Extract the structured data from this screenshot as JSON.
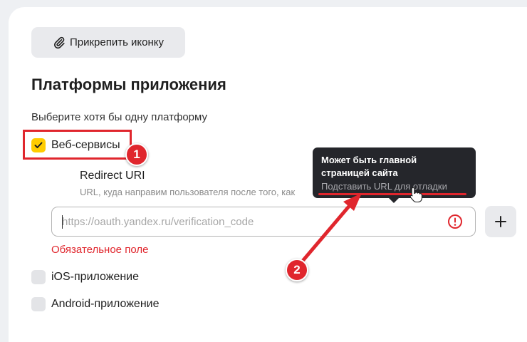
{
  "attach_button": {
    "label": "Прикрепить иконку",
    "icon": "paperclip-icon"
  },
  "platforms": {
    "title": "Платформы приложения",
    "hint": "Выберите хотя бы одну платформу",
    "web": {
      "label": "Веб-сервисы",
      "checked": true
    },
    "ios": {
      "label": "iOS-приложение",
      "checked": false
    },
    "android": {
      "label": "Android-приложение",
      "checked": false
    }
  },
  "redirect": {
    "label": "Redirect URI",
    "description": "URL, куда направим пользователя после того, как",
    "value": "",
    "placeholder": "https://oauth.yandex.ru/verification_code",
    "error": "Обязательное поле",
    "add_icon": "plus-icon"
  },
  "tooltip": {
    "title_line1": "Может быть главной",
    "title_line2": "страницей сайта",
    "link": "Подставить URL для отладки"
  },
  "annotations": {
    "badge1": "1",
    "badge2": "2",
    "color": "#e0262d"
  },
  "colors": {
    "checkbox_checked": "#ffcc00",
    "error": "#e0262d",
    "tooltip_bg": "#25262b"
  }
}
